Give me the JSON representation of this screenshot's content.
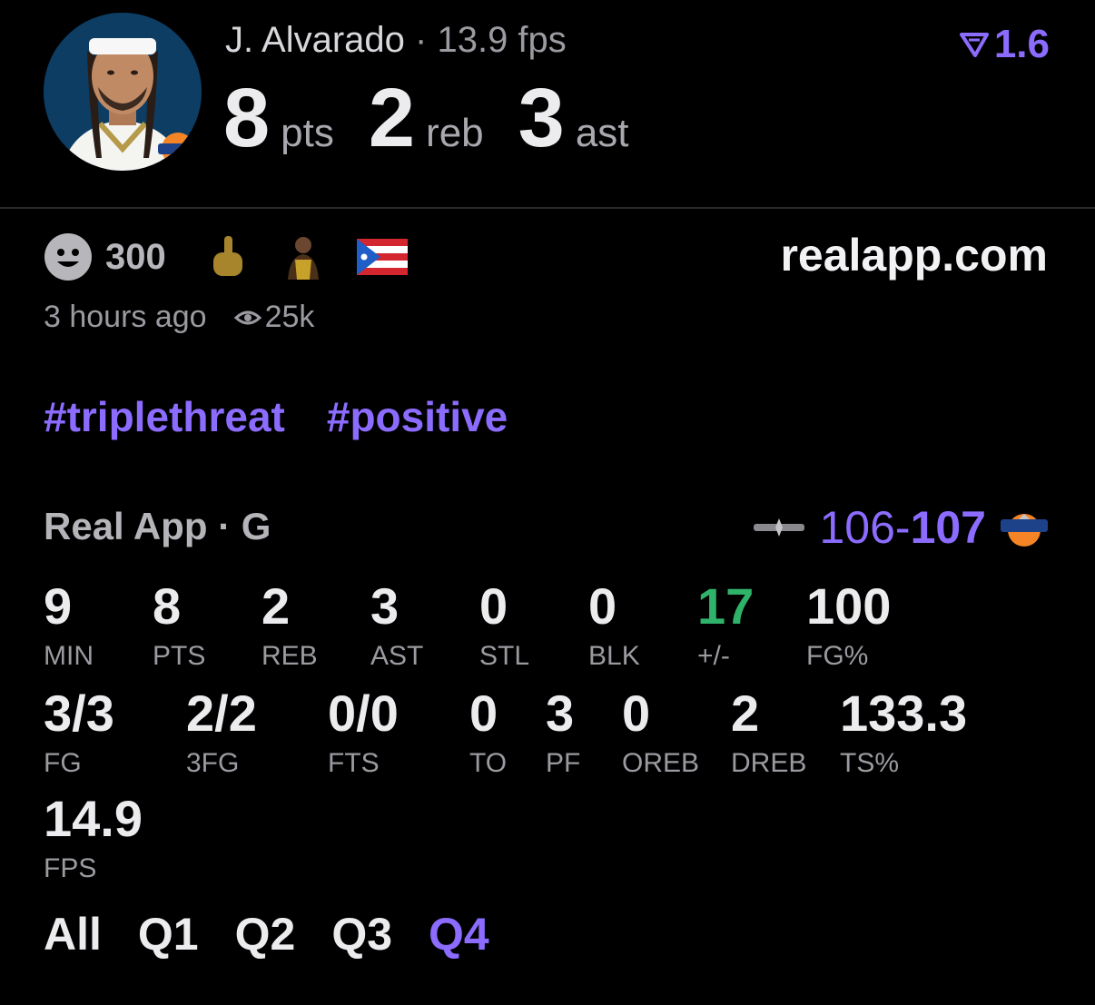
{
  "header": {
    "player_name": "J. Alvarado",
    "separator": "·",
    "fps_text": "13.9 fps",
    "rating": "1.6",
    "rating_icon": "real-logo-icon",
    "stats": [
      {
        "value": "8",
        "unit": "pts"
      },
      {
        "value": "2",
        "unit": "reb"
      },
      {
        "value": "3",
        "unit": "ast"
      }
    ]
  },
  "meta": {
    "reaction_icon": "smiley-icon",
    "reaction_count": "300",
    "emojis": [
      "middle-finger-emoji",
      "player-sticker",
      "puerto-rico-flag"
    ],
    "site": "realapp.com",
    "time_ago": "3 hours ago",
    "views": "25k"
  },
  "tags": [
    "#triplethreat",
    "#positive"
  ],
  "game": {
    "league": "Real App · G",
    "score_away": "106",
    "score_dash": "-",
    "score_home": "107",
    "home_team_logo": "knicks-logo",
    "away_team_logo": "spurs-logo"
  },
  "stats_row1": [
    {
      "value": "9",
      "label": "MIN"
    },
    {
      "value": "8",
      "label": "PTS"
    },
    {
      "value": "2",
      "label": "REB"
    },
    {
      "value": "3",
      "label": "AST"
    },
    {
      "value": "0",
      "label": "STL"
    },
    {
      "value": "0",
      "label": "BLK"
    },
    {
      "value": "17",
      "label": "+/-"
    },
    {
      "value": "100",
      "label": "FG%"
    }
  ],
  "stats_row2": [
    {
      "value": "3/3",
      "label": "FG"
    },
    {
      "value": "2/2",
      "label": "3FG"
    },
    {
      "value": "0/0",
      "label": "FTS"
    },
    {
      "value": "0",
      "label": "TO"
    },
    {
      "value": "3",
      "label": "PF"
    },
    {
      "value": "0",
      "label": "OREB"
    },
    {
      "value": "2",
      "label": "DREB"
    },
    {
      "value": "133.3",
      "label": "TS%"
    }
  ],
  "stats_row3": [
    {
      "value": "14.9",
      "label": "FPS"
    }
  ],
  "quarters": {
    "tabs": [
      "All",
      "Q1",
      "Q2",
      "Q3",
      "Q4"
    ],
    "active": "Q4"
  },
  "colors": {
    "accent": "#8b6cff",
    "positive": "#2fb36a",
    "background": "#000000"
  }
}
